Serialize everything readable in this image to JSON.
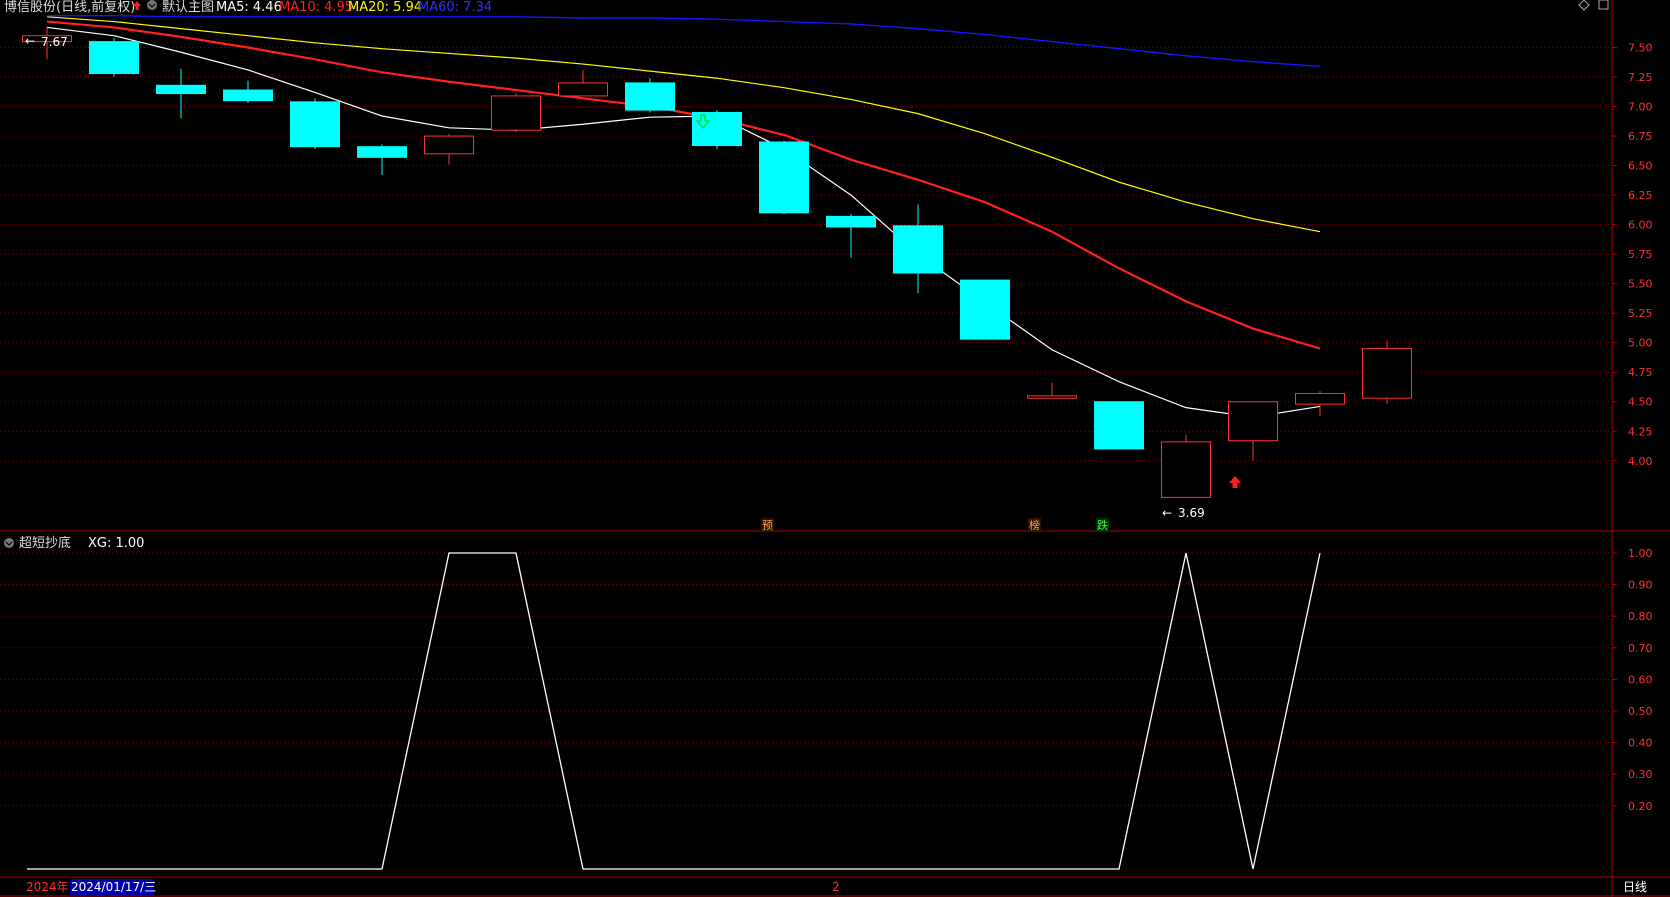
{
  "header": {
    "stock_name": "博信股份(日线,前复权)",
    "indicator_group": "默认主图",
    "ma5_label": "MA5: 4.46",
    "ma10_label": "MA10: 4.95",
    "ma20_label": "MA20: 5.94",
    "ma60_label": "MA60: 7.34"
  },
  "sub_header": {
    "indicator_name": "超短抄底",
    "xg_label": "XG: 1.00"
  },
  "footer": {
    "year_label": "2024年",
    "date_label": "2024/01/17/三",
    "month_marker": "2",
    "period_label": "日线"
  },
  "annotations": {
    "high_label": "7.67",
    "low_label": "3.69",
    "tags": [
      "预",
      "榜",
      "跌"
    ]
  },
  "colors": {
    "up": "#ff3232",
    "down": "#00ffff",
    "ma5": "#ffffff",
    "ma10": "#ff2020",
    "ma20": "#ffff00",
    "ma60": "#1515ff",
    "axis": "#b00000",
    "grid": "#8a0000",
    "xg": "#ffffff"
  },
  "chart_data": [
    {
      "type": "candlestick",
      "title": "博信股份(日线,前复权)",
      "ylim": [
        3.6,
        7.75
      ],
      "yticks": [
        4.0,
        4.25,
        4.5,
        4.75,
        5.0,
        5.25,
        5.5,
        5.75,
        6.0,
        6.25,
        6.5,
        6.75,
        7.0,
        7.25,
        7.5
      ],
      "candles": [
        {
          "open": 7.55,
          "close": 7.6,
          "high": 7.67,
          "low": 7.4
        },
        {
          "open": 7.55,
          "close": 7.28,
          "high": 7.58,
          "low": 7.25
        },
        {
          "open": 7.18,
          "close": 7.11,
          "high": 7.32,
          "low": 6.9
        },
        {
          "open": 7.14,
          "close": 7.05,
          "high": 7.22,
          "low": 7.03
        },
        {
          "open": 7.04,
          "close": 6.66,
          "high": 7.07,
          "low": 6.64
        },
        {
          "open": 6.66,
          "close": 6.57,
          "high": 6.68,
          "low": 6.42
        },
        {
          "open": 6.6,
          "close": 6.75,
          "high": 6.77,
          "low": 6.51
        },
        {
          "open": 6.8,
          "close": 7.09,
          "high": 7.11,
          "low": 6.78
        },
        {
          "open": 7.09,
          "close": 7.2,
          "high": 7.31,
          "low": 7.09
        },
        {
          "open": 7.2,
          "close": 6.97,
          "high": 7.24,
          "low": 6.95
        },
        {
          "open": 6.95,
          "close": 6.67,
          "high": 6.97,
          "low": 6.64
        },
        {
          "open": 6.7,
          "close": 6.1,
          "high": 6.71,
          "low": 6.09
        },
        {
          "open": 6.07,
          "close": 5.98,
          "high": 6.09,
          "low": 5.72
        },
        {
          "open": 5.99,
          "close": 5.59,
          "high": 6.17,
          "low": 5.42
        },
        {
          "open": 5.53,
          "close": 5.03,
          "high": 5.53,
          "low": 5.03
        },
        {
          "open": 4.53,
          "close": 4.55,
          "high": 4.66,
          "low": 4.53
        },
        {
          "open": 4.5,
          "close": 4.1,
          "high": 4.5,
          "low": 4.1
        },
        {
          "open": 3.69,
          "close": 4.16,
          "high": 4.22,
          "low": 3.69
        },
        {
          "open": 4.17,
          "close": 4.5,
          "high": 4.5,
          "low": 4.0
        },
        {
          "open": 4.48,
          "close": 4.57,
          "high": 4.59,
          "low": 4.38
        },
        {
          "open": 4.53,
          "close": 4.95,
          "high": 5.02,
          "low": 4.48
        }
      ],
      "ma": [
        {
          "name": "MA5",
          "values": [
            7.67,
            7.6,
            7.46,
            7.31,
            7.12,
            6.92,
            6.82,
            6.8,
            6.85,
            6.91,
            6.92,
            6.64,
            6.25,
            5.75,
            5.34,
            4.94,
            4.67,
            4.45,
            4.37,
            4.46
          ]
        },
        {
          "name": "MA10",
          "values": [
            7.72,
            7.67,
            7.59,
            7.5,
            7.4,
            7.29,
            7.21,
            7.14,
            7.07,
            7.0,
            6.9,
            6.76,
            6.55,
            6.38,
            6.19,
            5.94,
            5.63,
            5.35,
            5.12,
            4.95
          ]
        },
        {
          "name": "MA20",
          "values": [
            7.76,
            7.72,
            7.66,
            7.6,
            7.54,
            7.49,
            7.45,
            7.41,
            7.36,
            7.3,
            7.24,
            7.16,
            7.06,
            6.94,
            6.77,
            6.57,
            6.36,
            6.19,
            6.05,
            5.94
          ]
        },
        {
          "name": "MA60",
          "values": [
            7.77,
            7.77,
            7.76,
            7.76,
            7.76,
            7.76,
            7.76,
            7.76,
            7.75,
            7.75,
            7.74,
            7.72,
            7.7,
            7.66,
            7.61,
            7.55,
            7.49,
            7.43,
            7.38,
            7.34
          ]
        }
      ]
    },
    {
      "type": "line",
      "title": "超短抄底",
      "series": [
        {
          "name": "XG",
          "values": [
            0,
            0,
            0,
            0,
            0,
            0,
            1,
            1,
            0,
            0,
            0,
            0,
            0,
            0,
            0,
            0,
            0,
            1,
            0,
            1
          ]
        }
      ],
      "ylim": [
        0,
        1
      ],
      "yticks": [
        0.2,
        0.3,
        0.4,
        0.5,
        0.6,
        0.7,
        0.8,
        0.9,
        1.0
      ]
    }
  ]
}
